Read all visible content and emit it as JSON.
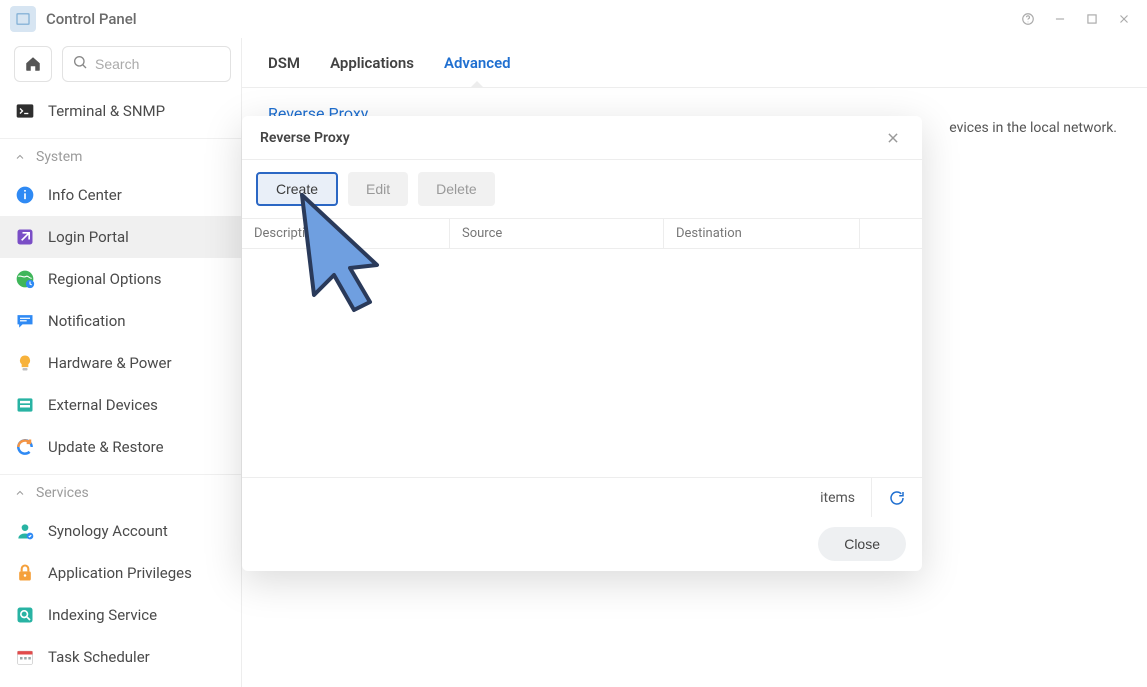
{
  "window": {
    "title": "Control Panel"
  },
  "sidebar": {
    "search_placeholder": "Search",
    "top_item": {
      "label": "Terminal & SNMP"
    },
    "groups": [
      {
        "label": "System",
        "items": [
          {
            "label": "Info Center"
          },
          {
            "label": "Login Portal",
            "active": true
          },
          {
            "label": "Regional Options"
          },
          {
            "label": "Notification"
          },
          {
            "label": "Hardware & Power"
          },
          {
            "label": "External Devices"
          },
          {
            "label": "Update & Restore"
          }
        ]
      },
      {
        "label": "Services",
        "items": [
          {
            "label": "Synology Account"
          },
          {
            "label": "Application Privileges"
          },
          {
            "label": "Indexing Service"
          },
          {
            "label": "Task Scheduler"
          }
        ]
      }
    ]
  },
  "tabs": {
    "dsm": "DSM",
    "applications": "Applications",
    "advanced": "Advanced"
  },
  "section": {
    "title": "Reverse Proxy"
  },
  "behind_text": "evices in the local network.",
  "modal": {
    "title": "Reverse Proxy",
    "buttons": {
      "create": "Create",
      "edit": "Edit",
      "delete": "Delete"
    },
    "columns": {
      "description": "Description",
      "source": "Source",
      "destination": "Destination"
    },
    "status_items": "items",
    "close": "Close"
  }
}
